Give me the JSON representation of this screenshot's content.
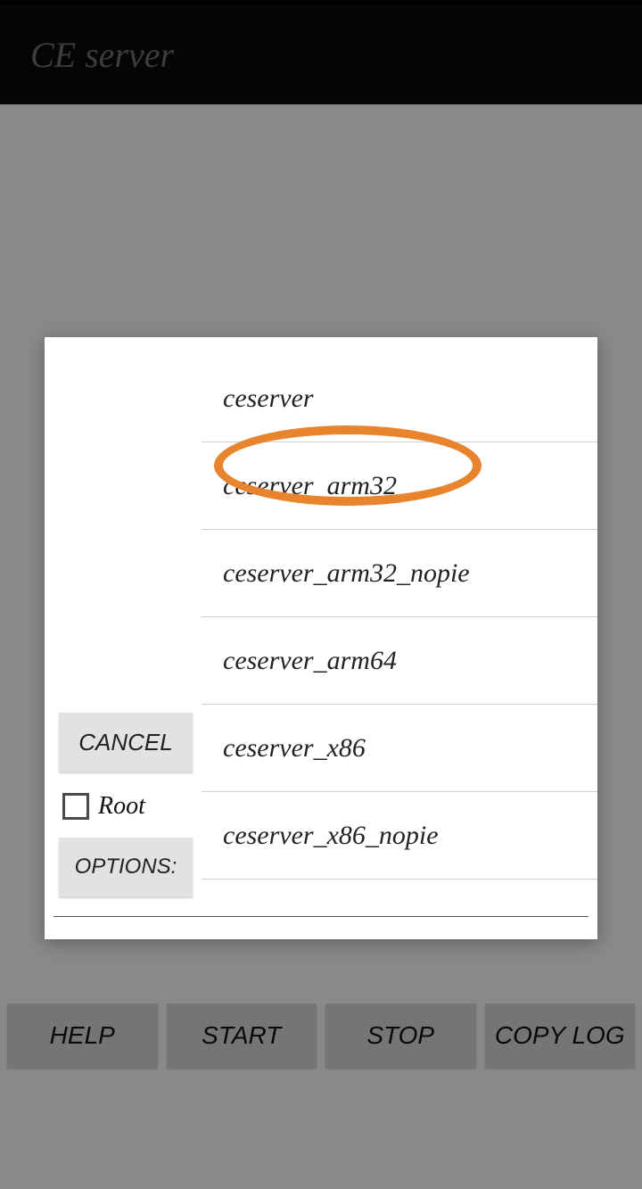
{
  "header": {
    "title": "CE server"
  },
  "buttons": {
    "help": "HELP",
    "start": "START",
    "stop": "STOP",
    "copylog": "COPY LOG"
  },
  "dialog": {
    "cancel": "CANCEL",
    "root": "Root",
    "options": "OPTIONS:",
    "items": [
      "ceserver",
      "ceserver_arm32",
      "ceserver_arm32_nopie",
      "ceserver_arm64",
      "ceserver_x86",
      "ceserver_x86_nopie"
    ]
  },
  "annotation": {
    "highlighted_index": 1
  }
}
